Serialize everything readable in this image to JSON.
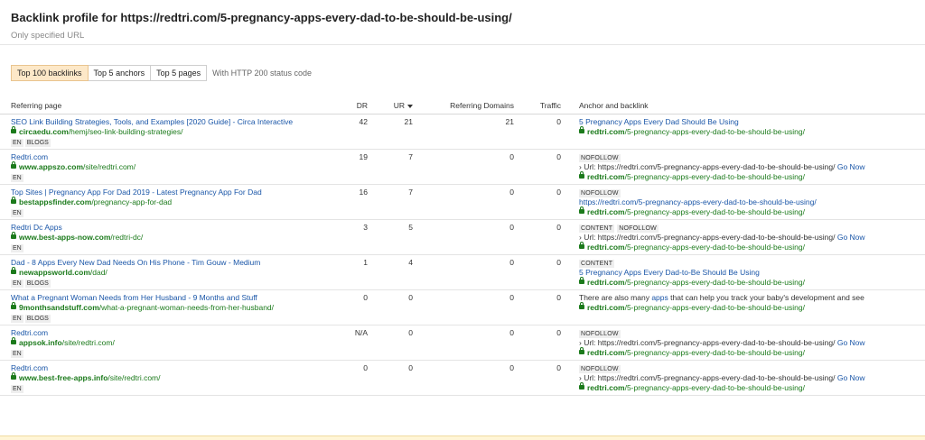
{
  "header": {
    "title": "Backlink profile for https://redtri.com/5-pregnancy-apps-every-dad-to-be-should-be-using/",
    "subtitle": "Only specified URL"
  },
  "filters": {
    "tabs": [
      {
        "label": "Top 100 backlinks",
        "active": true
      },
      {
        "label": "Top 5 anchors",
        "active": false
      },
      {
        "label": "Top 5 pages",
        "active": false
      }
    ],
    "note": "With HTTP 200 status code"
  },
  "columns": {
    "referring_page": "Referring page",
    "dr": "DR",
    "ur": "UR",
    "referring_domains": "Referring Domains",
    "traffic": "Traffic",
    "anchor": "Anchor and backlink"
  },
  "rows": [
    {
      "title": "SEO Link Building Strategies, Tools, and Examples [2020 Guide] - Circa Interactive",
      "domain": "circaedu.com",
      "path": "/hemj/seo-link-building-strategies/",
      "tags": [
        "EN",
        "BLOGS"
      ],
      "dr": "42",
      "ur": "21",
      "rd": "21",
      "traffic": "0",
      "badges": [],
      "anchor_text": "5 Pregnancy Apps Every Dad Should Be Using",
      "via": "",
      "backlink_domain": "redtri.com",
      "backlink_path": "/5-pregnancy-apps-every-dad-to-be-should-be-using/"
    },
    {
      "title": "Redtri.com",
      "domain": "www.appszo.com",
      "path": "/site/redtri.com/",
      "tags": [
        "EN"
      ],
      "dr": "19",
      "ur": "7",
      "rd": "0",
      "traffic": "0",
      "badges": [
        "NOFOLLOW"
      ],
      "anchor_text": "",
      "via": "› Url: https://redtri.com/5-pregnancy-apps-every-dad-to-be-should-be-using/",
      "go": "Go Now",
      "backlink_domain": "redtri.com",
      "backlink_path": "/5-pregnancy-apps-every-dad-to-be-should-be-using/"
    },
    {
      "title": "Top Sites | Pregnancy App For Dad 2019 - Latest Pregnancy App For Dad",
      "domain": "bestappsfinder.com",
      "path": "/pregnancy-app-for-dad",
      "tags": [
        "EN"
      ],
      "dr": "16",
      "ur": "7",
      "rd": "0",
      "traffic": "0",
      "badges": [
        "NOFOLLOW"
      ],
      "raw_link": "https://redtri.com/5-pregnancy-apps-every-dad-to-be-should-be-using/",
      "backlink_domain": "redtri.com",
      "backlink_path": "/5-pregnancy-apps-every-dad-to-be-should-be-using/"
    },
    {
      "title": "Redtri Dc Apps",
      "domain": "www.best-apps-now.com",
      "path": "/redtri-dc/",
      "tags": [
        "EN"
      ],
      "dr": "3",
      "ur": "5",
      "rd": "0",
      "traffic": "0",
      "badges": [
        "CONTENT",
        "NOFOLLOW"
      ],
      "via": "› Url: https://redtri.com/5-pregnancy-apps-every-dad-to-be-should-be-using/",
      "go": "Go Now",
      "backlink_domain": "redtri.com",
      "backlink_path": "/5-pregnancy-apps-every-dad-to-be-should-be-using/"
    },
    {
      "title": "Dad - 8 Apps Every New Dad Needs On His Phone - Tim Gouw - Medium",
      "domain": "newappsworld.com",
      "path": "/dad/",
      "tags": [
        "EN",
        "BLOGS"
      ],
      "dr": "1",
      "ur": "4",
      "rd": "0",
      "traffic": "0",
      "badges": [
        "CONTENT"
      ],
      "anchor_text": "5 Pregnancy Apps Every Dad-to-Be Should Be Using",
      "backlink_domain": "redtri.com",
      "backlink_path": "/5-pregnancy-apps-every-dad-to-be-should-be-using/"
    },
    {
      "title": "What a Pregnant Woman Needs from Her Husband - 9 Months and Stuff",
      "domain": "9monthsandstuff.com",
      "path": "/what-a-pregnant-woman-needs-from-her-husband/",
      "tags": [
        "EN",
        "BLOGS"
      ],
      "dr": "0",
      "ur": "0",
      "rd": "0",
      "traffic": "0",
      "badges": [],
      "context_before": "There are also many ",
      "context_link": "apps",
      "context_after": " that can help you track your baby's development and see",
      "backlink_domain": "redtri.com",
      "backlink_path": "/5-pregnancy-apps-every-dad-to-be-should-be-using/"
    },
    {
      "title": "Redtri.com",
      "domain": "appsok.info",
      "path": "/site/redtri.com/",
      "tags": [
        "EN"
      ],
      "dr": "N/A",
      "ur": "0",
      "rd": "0",
      "traffic": "0",
      "badges": [
        "NOFOLLOW"
      ],
      "via": "› Url: https://redtri.com/5-pregnancy-apps-every-dad-to-be-should-be-using/",
      "go": "Go Now",
      "backlink_domain": "redtri.com",
      "backlink_path": "/5-pregnancy-apps-every-dad-to-be-should-be-using/"
    },
    {
      "title": "Redtri.com",
      "domain": "www.best-free-apps.info",
      "path": "/site/redtri.com/",
      "tags": [
        "EN"
      ],
      "dr": "0",
      "ur": "0",
      "rd": "0",
      "traffic": "0",
      "badges": [
        "NOFOLLOW"
      ],
      "via": "› Url: https://redtri.com/5-pregnancy-apps-every-dad-to-be-should-be-using/",
      "go": "Go Now",
      "backlink_domain": "redtri.com",
      "backlink_path": "/5-pregnancy-apps-every-dad-to-be-should-be-using/"
    }
  ],
  "icons": {
    "secure": "lock-icon",
    "sort": "sort-desc-icon"
  },
  "colors": {
    "link": "#1a56a8",
    "url_green": "#1b7a1b",
    "active_tab": "#fde8c8"
  }
}
